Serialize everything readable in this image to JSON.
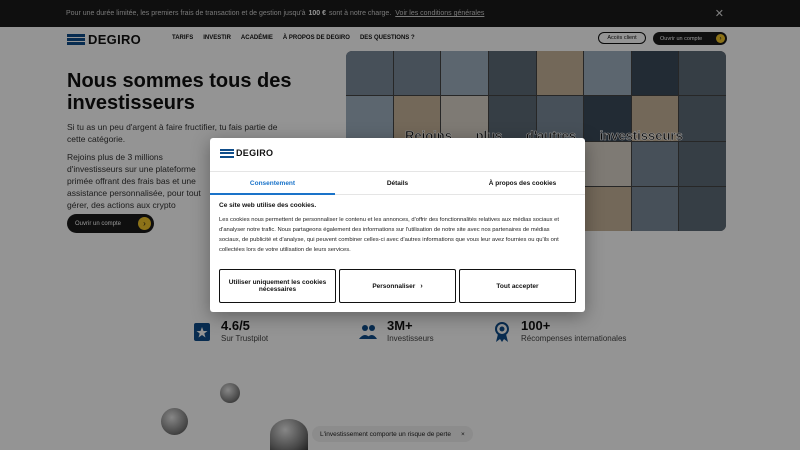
{
  "banner": {
    "text_before": "Pour une durée limitée, les premiers frais de transaction et de gestion jusqu'à",
    "amount": "100 €",
    "text_after": "sont à notre charge.",
    "link": "Voir les conditions générales",
    "close_icon": "close-icon"
  },
  "header": {
    "logo": "DEGIRO",
    "nav": [
      "TARIFS",
      "INVESTIR",
      "ACADÉMIE",
      "À PROPOS DE DEGIRO",
      "DES QUESTIONS ?"
    ],
    "client_button": "Accès client",
    "open_account_button": "Ouvrir un compte",
    "arrow": "›"
  },
  "hero": {
    "title": "Nous sommes tous des investisseurs",
    "p1": "Si tu as un peu d'argent à faire fructifier, tu fais partie de cette catégorie.",
    "p2": "Rejoins plus de 3 millions d'investisseurs sur une plateforme primée offrant des frais bas et une assistance personnalisée, pour tout gérer, des actions aux crypto",
    "button": "Ouvrir un compte",
    "arrow": "›",
    "mosaic_text": "Rejoins plus d'autres investisseurs"
  },
  "stats": [
    {
      "value": "4.6/5",
      "label": "Sur Trustpilot",
      "icon": "trustpilot-icon"
    },
    {
      "value": "3M+",
      "label": "Investisseurs",
      "icon": "users-icon"
    },
    {
      "value": "100+",
      "label": "Récompenses internationales",
      "icon": "award-icon"
    }
  ],
  "risk": {
    "text": "L'investissement comporte un risque de perte",
    "close": "×"
  },
  "modal": {
    "logo": "DEGIRO",
    "tabs": [
      "Consentement",
      "Détails",
      "À propos des cookies"
    ],
    "active_tab": 0,
    "heading": "Ce site web utilise des cookies.",
    "body": "Les cookies nous permettent de personnaliser le contenu et les annonces, d'offrir des fonctionnalités relatives aux médias sociaux et d'analyser notre trafic. Nous partageons également des informations sur l'utilisation de notre site avec nos partenaires de médias sociaux, de publicité et d'analyse, qui peuvent combiner celles-ci avec d'autres informations que vous leur avez fournies ou qu'ils ont collectées lors de votre utilisation de leurs services.",
    "buttons": {
      "necessary": "Utiliser uniquement les cookies nécessaires",
      "customize": "Personnaliser",
      "accept_all": "Tout accepter",
      "chevron": "›"
    }
  },
  "colors": {
    "brand_blue": "#0f4d8a",
    "accent_yellow": "#f2c52a",
    "tab_active": "#1a73c9",
    "banner_bg": "#1b1b1b"
  }
}
